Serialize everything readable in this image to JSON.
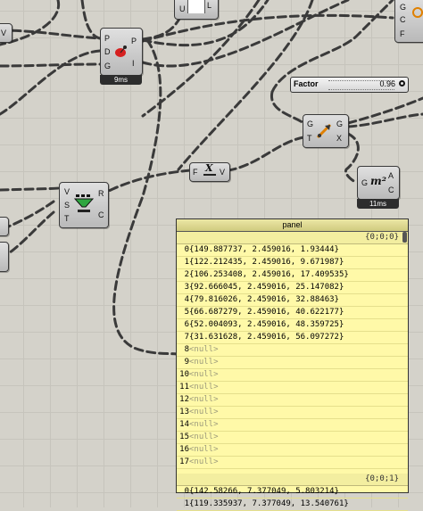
{
  "components": {
    "top_left_partial": {
      "port": "V"
    },
    "top_right_partial": {
      "u": "U",
      "l": "L"
    },
    "right_edge_partial": {
      "g": "G",
      "c": "C",
      "f": "F"
    },
    "main_comp": {
      "in_p": "P",
      "in_d": "D",
      "in_g": "G",
      "out_p": "P",
      "out_i": "I",
      "timer": "9ms"
    },
    "slider": {
      "label": "Factor",
      "value": "0.96"
    },
    "scale_comp": {
      "in_g": "G",
      "in_t": "T",
      "out_g": "G",
      "out_x": "X"
    },
    "expr_comp": {
      "in_f": "F",
      "out_v": "V",
      "symbol": "X"
    },
    "area_comp": {
      "in_g": "G",
      "out_a": "A",
      "out_c": "C",
      "symbol": "m²",
      "timer": "11ms"
    },
    "vst_comp": {
      "in_v": "V",
      "in_s": "S",
      "in_t": "T",
      "out_r": "R",
      "out_c": "C"
    }
  },
  "panel": {
    "title": "panel",
    "path1": "{0;0;0}",
    "rows1": [
      {
        "i": "0",
        "v": "{149.887737, 2.459016, 1.93444}"
      },
      {
        "i": "1",
        "v": "{122.212435, 2.459016, 9.671987}"
      },
      {
        "i": "2",
        "v": "{106.253408, 2.459016, 17.409535}"
      },
      {
        "i": "3",
        "v": "{92.666045, 2.459016, 25.147082}"
      },
      {
        "i": "4",
        "v": "{79.816026, 2.459016, 32.88463}"
      },
      {
        "i": "5",
        "v": "{66.687279, 2.459016, 40.622177}"
      },
      {
        "i": "6",
        "v": "{52.004093, 2.459016, 48.359725}"
      },
      {
        "i": "7",
        "v": "{31.631628, 2.459016, 56.097272}"
      },
      {
        "i": "8",
        "v": "<null>"
      },
      {
        "i": "9",
        "v": "<null>"
      },
      {
        "i": "10",
        "v": "<null>"
      },
      {
        "i": "11",
        "v": "<null>"
      },
      {
        "i": "12",
        "v": "<null>"
      },
      {
        "i": "13",
        "v": "<null>"
      },
      {
        "i": "14",
        "v": "<null>"
      },
      {
        "i": "15",
        "v": "<null>"
      },
      {
        "i": "16",
        "v": "<null>"
      },
      {
        "i": "17",
        "v": "<null>"
      }
    ],
    "path2": "{0;0;1}",
    "rows2": [
      {
        "i": "0",
        "v": "{142.58266, 7.377049, 5.803214}"
      },
      {
        "i": "1",
        "v": "{119.335937, 7.377049, 13.540761}"
      }
    ]
  }
}
